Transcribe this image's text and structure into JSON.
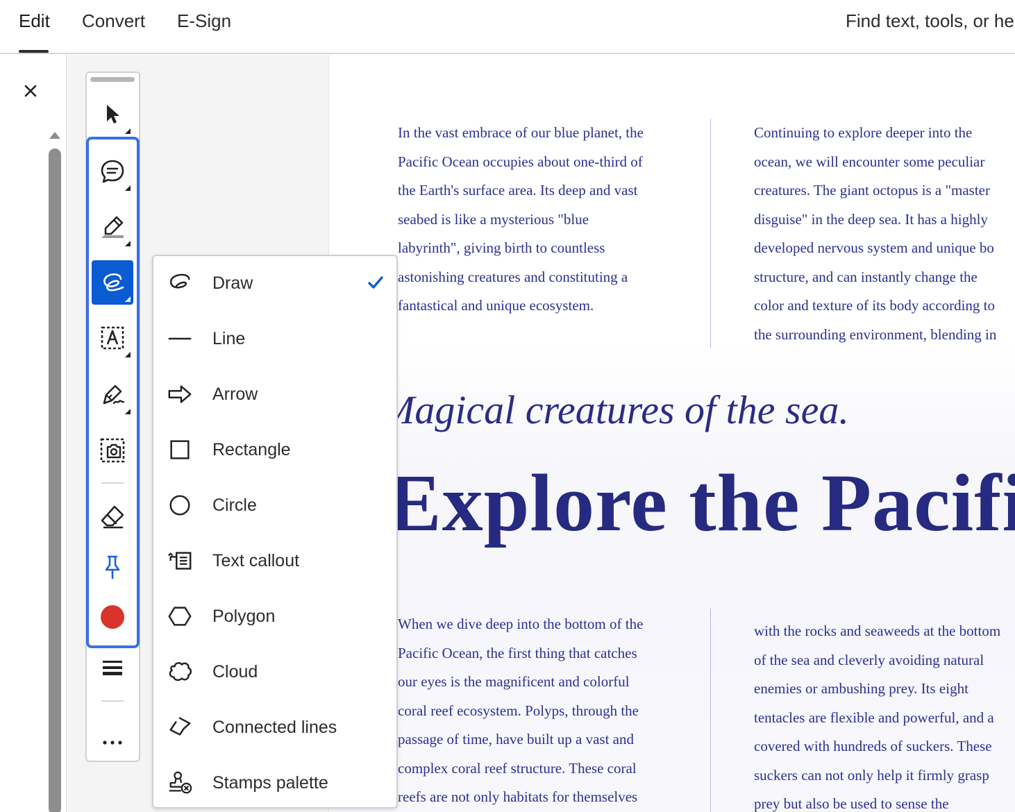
{
  "header": {
    "tabs": [
      {
        "label": "Edit",
        "active": true
      },
      {
        "label": "Convert",
        "active": false
      },
      {
        "label": "E-Sign",
        "active": false
      }
    ],
    "search_placeholder": "Find text, tools, or hel"
  },
  "left_pane": {
    "close_icon": "close-icon",
    "scroll_up_icon": "caret-up-icon"
  },
  "toolbar": {
    "tools": [
      {
        "name": "select",
        "icon": "pointer-arrow-icon"
      },
      {
        "name": "comment",
        "icon": "comment-bubble-icon"
      },
      {
        "name": "highlight",
        "icon": "highlighter-icon"
      },
      {
        "name": "draw",
        "icon": "freehand-draw-icon",
        "active": true
      },
      {
        "name": "text-box",
        "icon": "text-box-icon"
      },
      {
        "name": "signature",
        "icon": "pen-sign-icon"
      },
      {
        "name": "snapshot",
        "icon": "camera-capture-icon"
      },
      {
        "name": "eraser",
        "icon": "eraser-icon"
      },
      {
        "name": "pin",
        "icon": "pin-icon"
      },
      {
        "name": "color",
        "icon": "color-swatch-icon",
        "color": "#d9342b"
      },
      {
        "name": "line-weight",
        "icon": "line-weight-icon"
      },
      {
        "name": "more",
        "icon": "more-dots-icon"
      }
    ],
    "group_border_color": "#3a6fe6",
    "active_color": "#0b5bd3"
  },
  "shape_menu": {
    "items": [
      {
        "label": "Draw",
        "icon": "freehand-draw-icon",
        "checked": true
      },
      {
        "label": "Line",
        "icon": "line-icon"
      },
      {
        "label": "Arrow",
        "icon": "arrow-icon"
      },
      {
        "label": "Rectangle",
        "icon": "rectangle-icon"
      },
      {
        "label": "Circle",
        "icon": "circle-icon"
      },
      {
        "label": "Text callout",
        "icon": "text-callout-icon"
      },
      {
        "label": "Polygon",
        "icon": "polygon-icon"
      },
      {
        "label": "Cloud",
        "icon": "cloud-icon"
      },
      {
        "label": "Connected lines",
        "icon": "connected-lines-icon"
      },
      {
        "label": "Stamps palette",
        "icon": "stamps-palette-icon"
      }
    ],
    "check_color": "#0b5bd3"
  },
  "document": {
    "top_left": [
      "In the vast embrace of our blue planet, the",
      "Pacific Ocean occupies about one-third of",
      "the Earth's surface area. Its deep and vast",
      "seabed is like a mysterious \"blue",
      "labyrinth\", giving birth to countless",
      "astonishing creatures and constituting a",
      "fantastical and unique ecosystem."
    ],
    "top_right": [
      "Continuing to explore deeper into the",
      "ocean, we will encounter some peculiar",
      "creatures. The giant octopus is a \"master",
      "disguise\" in the deep sea. It has a highly",
      "developed nervous system and unique bo",
      "structure, and can instantly change the",
      "color and texture of its body according to",
      "the surrounding environment, blending in"
    ],
    "subtitle": "Magical creatures of the sea.",
    "title": "Explore the Pacific",
    "bottom_left": [
      "When we dive deep into the bottom of the",
      "Pacific Ocean, the first thing that catches",
      "our eyes is the magnificent and colorful",
      "coral reef ecosystem. Polyps, through the",
      "passage of time, have built up a vast and",
      "complex coral reef structure. These coral",
      "reefs are not only habitats for themselves"
    ],
    "bottom_right": [
      "with the rocks and seaweeds at the bottom",
      "of the sea and cleverly avoiding natural",
      "enemies or ambushing prey. Its eight",
      "tentacles are flexible and powerful, and a",
      "covered with hundreds of suckers. These",
      "suckers can not only help it firmly grasp",
      "prey but also be used to sense the"
    ],
    "text_color": "#2d3090"
  }
}
